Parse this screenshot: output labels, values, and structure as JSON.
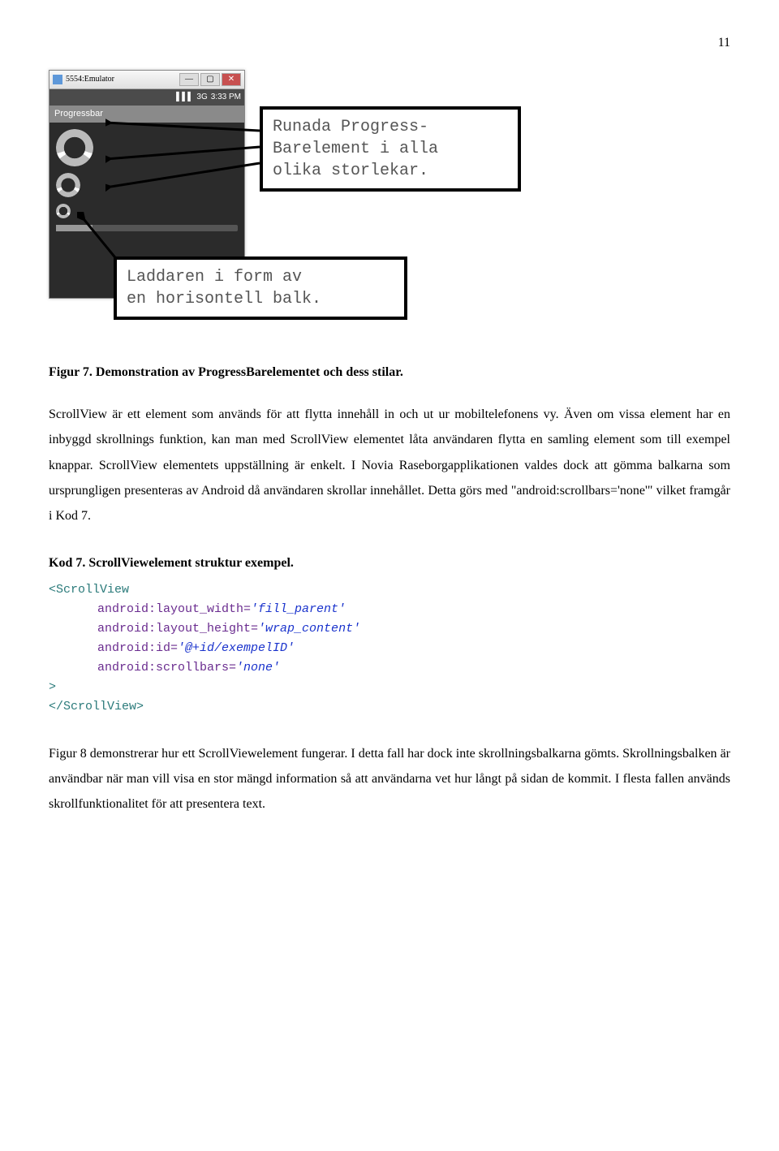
{
  "page_number": "11",
  "emulator": {
    "window_title": "5554:Emulator",
    "status_time": "3:33 PM",
    "app_title": "Progressbar"
  },
  "annotation1": "Runada Progress-\nBarelement i alla\nolika storlekar.",
  "annotation2": "Laddaren i form av\nen horisontell balk.",
  "figure_caption": "Figur 7. Demonstration av ProgressBarelementet och dess stilar.",
  "para1": "ScrollView är ett element som används för att flytta innehåll in och ut ur mobiltelefonens vy. Även om vissa element har en inbyggd skrollnings funktion, kan man med ScrollView elementet låta användaren flytta en samling element som till exempel knappar. ScrollView elementets uppställning är enkelt. I Novia Raseborgapplikationen valdes dock att gömma balkarna som ursprungligen presenteras av Android då användaren skrollar innehållet. Detta görs med \"android:scrollbars='none'\" vilket framgår i Kod 7.",
  "code_label": "Kod 7. ScrollViewelement struktur exempel.",
  "code": {
    "open_tag": "<ScrollView",
    "attr_width_name": "android:layout_width=",
    "attr_width_val": "'fill_parent'",
    "attr_height_name": "android:layout_height=",
    "attr_height_val": "'wrap_content'",
    "attr_id_name": "android:id=",
    "attr_id_val": "'@+id/exempelID'",
    "attr_scroll_name": "android:scrollbars=",
    "attr_scroll_val": "'none'",
    "close_open": ">",
    "close_tag": "</ScrollView>"
  },
  "para2": "Figur 8 demonstrerar hur ett ScrollViewelement fungerar. I detta fall har dock inte skrollningsbalkarna gömts. Skrollningsbalken är användbar när man vill visa en stor mängd information så att användarna vet hur långt på sidan de kommit. I flesta fallen används skrollfunktionalitet för att presentera text."
}
